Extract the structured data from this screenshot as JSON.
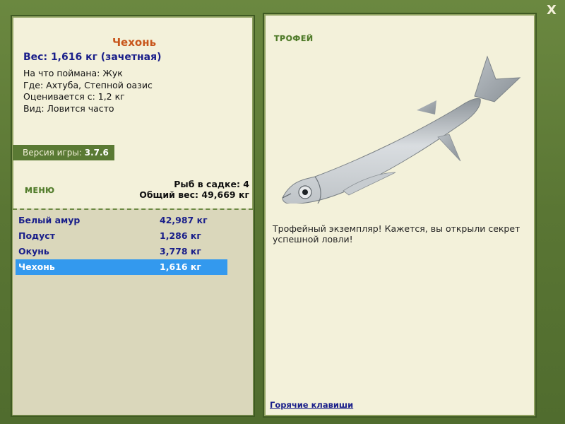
{
  "window": {
    "close_label": "X"
  },
  "fish": {
    "title": "Чехонь",
    "weight_line": "Вес: 1,616 кг (зачетная)",
    "caught_on": "На что поймана: Жук",
    "location": "Где: Ахтуба, Степной оазис",
    "rated_from": "Оценивается с: 1,2 кг",
    "frequency": "Вид: Ловится часто"
  },
  "version": {
    "label": "Версия игры:",
    "value": "3.7.6"
  },
  "menu": {
    "label": "МЕНЮ"
  },
  "cage": {
    "count_line": "Рыб в садке: 4",
    "total_line": "Общий вес: 49,669 кг"
  },
  "fish_list": [
    {
      "name": "Белый амур",
      "weight": "42,987 кг",
      "selected": false
    },
    {
      "name": "Подуст",
      "weight": "1,286 кг",
      "selected": false
    },
    {
      "name": "Окунь",
      "weight": "3,778 кг",
      "selected": false
    },
    {
      "name": "Чехонь",
      "weight": "1,616 кг",
      "selected": true
    }
  ],
  "trophy": {
    "label": "ТРОФЕЙ",
    "description": "Трофейный экземпляр! Кажется, вы открыли секрет успешной ловли!",
    "image_icon": "fish-image"
  },
  "links": {
    "hotkeys": "Горячие клавиши"
  },
  "colors": {
    "frame": "#5e7a36",
    "panel": "#f3f1da",
    "list_bg": "#dad7bb",
    "selected": "#3399ee",
    "title_orange": "#c8561c",
    "text_blue": "#1a1f8a"
  }
}
